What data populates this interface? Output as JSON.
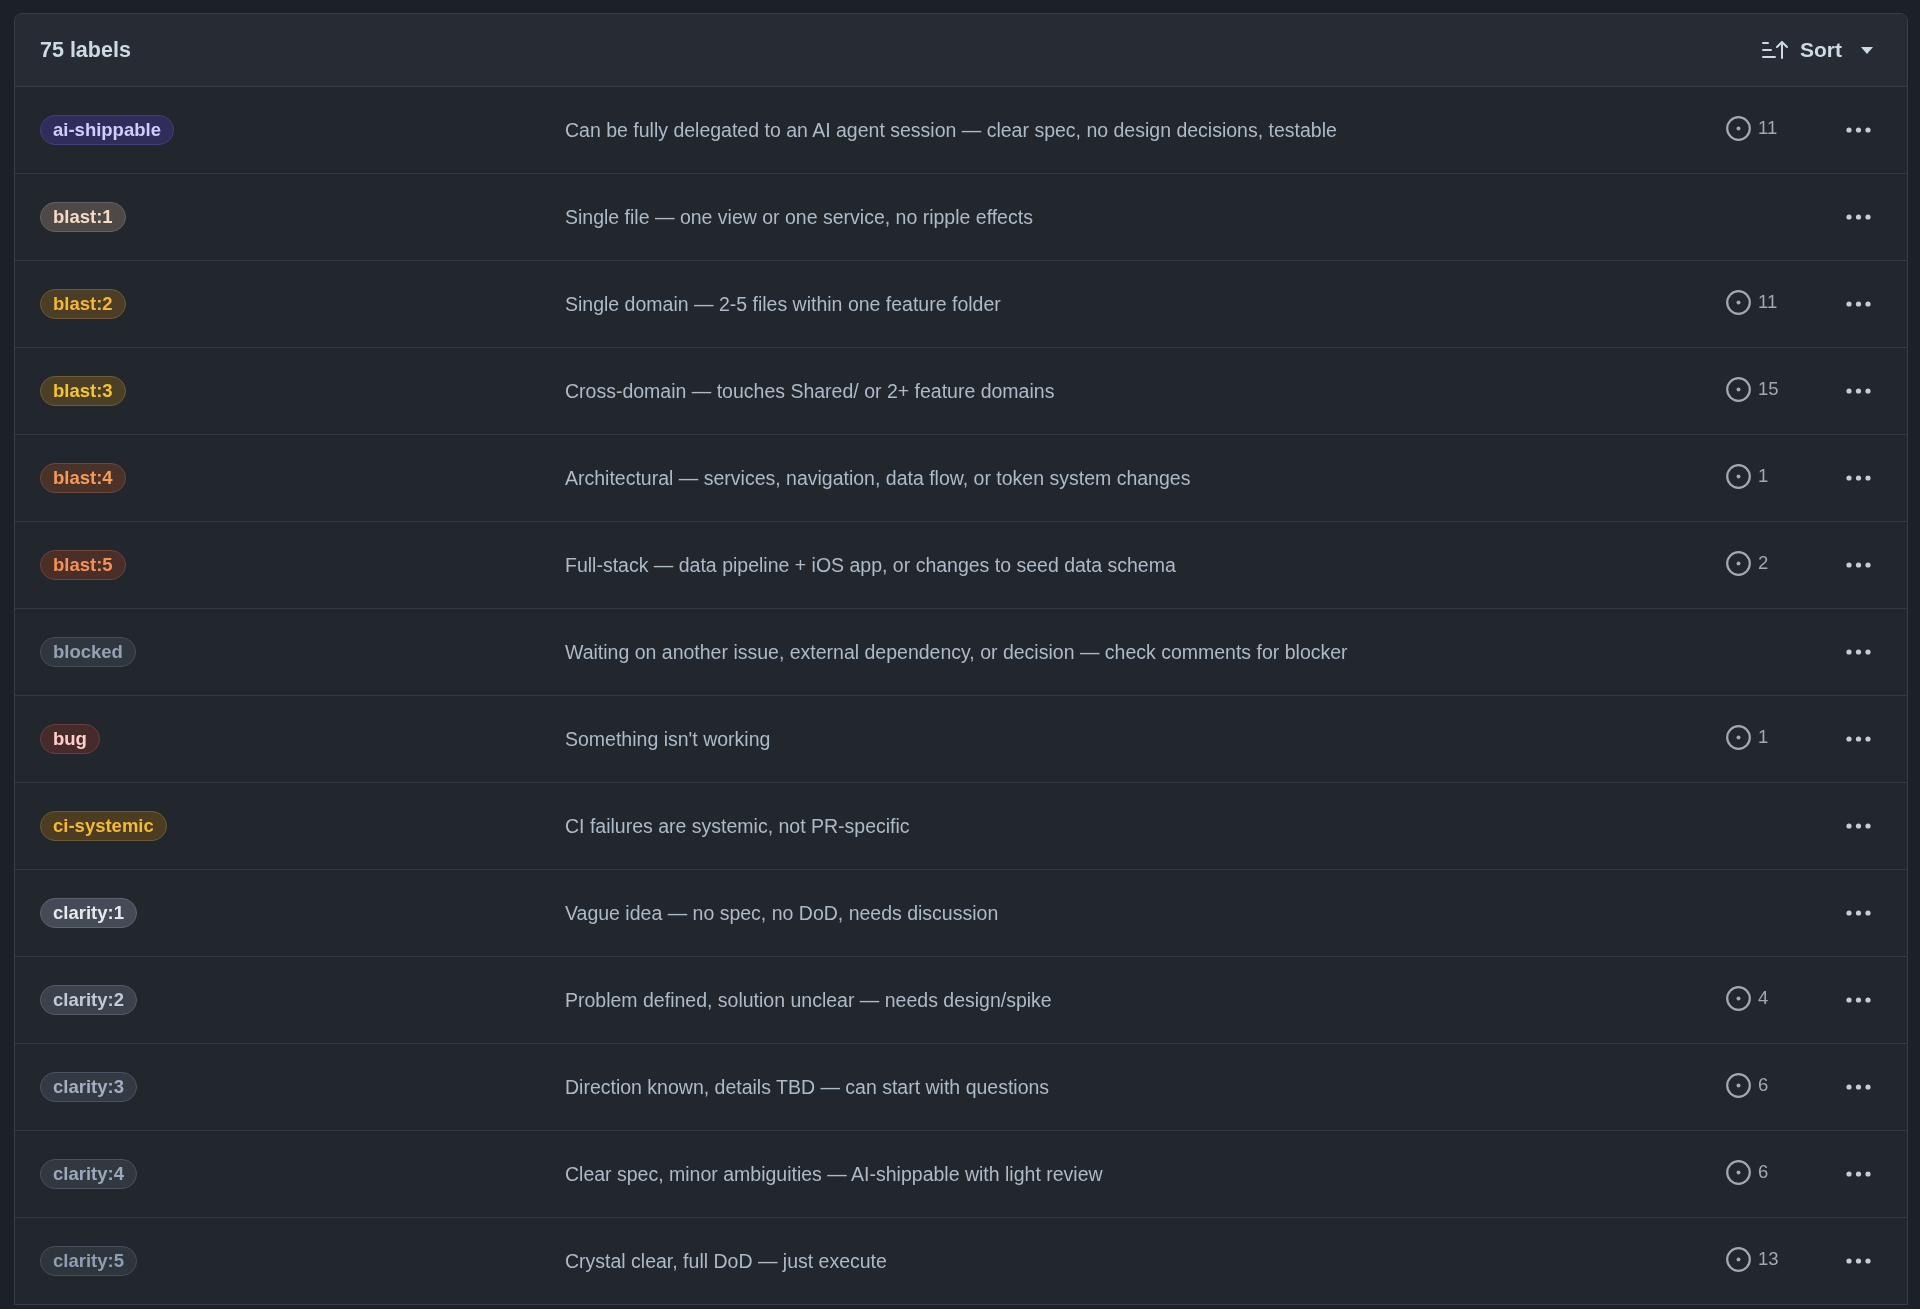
{
  "header": {
    "title": "75 labels",
    "sort_button": {
      "label": "Sort"
    }
  },
  "labels": [
    {
      "name": "ai-shippable",
      "color": "#312d5a",
      "description": "Can be fully delegated to an AI agent session — clear spec, no design decisions, testable",
      "open_issues": "11"
    },
    {
      "name": "blast:1",
      "color": "#4c4947",
      "description": "Single file — one view or one service, no ripple effects"
    },
    {
      "name": "blast:2",
      "color": "#4b3d26",
      "description": "Single domain — 2-5 files within one feature folder",
      "open_issues": "11"
    },
    {
      "name": "blast:3",
      "color": "#4b3f25",
      "description": "Cross-domain — touches Shared/ or 2+ feature domains",
      "open_issues": "15"
    },
    {
      "name": "blast:4",
      "color": "#4a3229",
      "description": "Architectural — services, navigation, data flow, or token system changes",
      "open_issues": "1"
    },
    {
      "name": "blast:5",
      "color": "#4a2f28",
      "description": "Full-stack — data pipeline + iOS app, or changes to seed data schema",
      "open_issues": "2"
    },
    {
      "name": "blocked",
      "color": "#30363e",
      "description": "Waiting on another issue, external dependency, or decision — check comments for blocker"
    },
    {
      "name": "bug",
      "color": "#472b2a",
      "description": "Something isn't working",
      "open_issues": "1"
    },
    {
      "name": "ci-systemic",
      "color": "#4b3c22",
      "description": "CI failures are systemic, not PR-specific"
    },
    {
      "name": "clarity:1",
      "color": "#454b56",
      "description": "Vague idea — no spec, no DoD, needs discussion"
    },
    {
      "name": "clarity:2",
      "color": "#3c424c",
      "description": "Problem defined, solution unclear — needs design/spike",
      "open_issues": "4"
    },
    {
      "name": "clarity:3",
      "color": "#343a43",
      "description": "Direction known, details TBD — can start with questions",
      "open_issues": "6"
    },
    {
      "name": "clarity:4",
      "color": "#323840",
      "description": "Clear spec, minor ambiguities — AI-shippable with light review",
      "open_issues": "6"
    },
    {
      "name": "clarity:5",
      "color": "#2f353d",
      "description": "Crystal clear, full DoD — just execute",
      "open_issues": "13"
    }
  ]
}
